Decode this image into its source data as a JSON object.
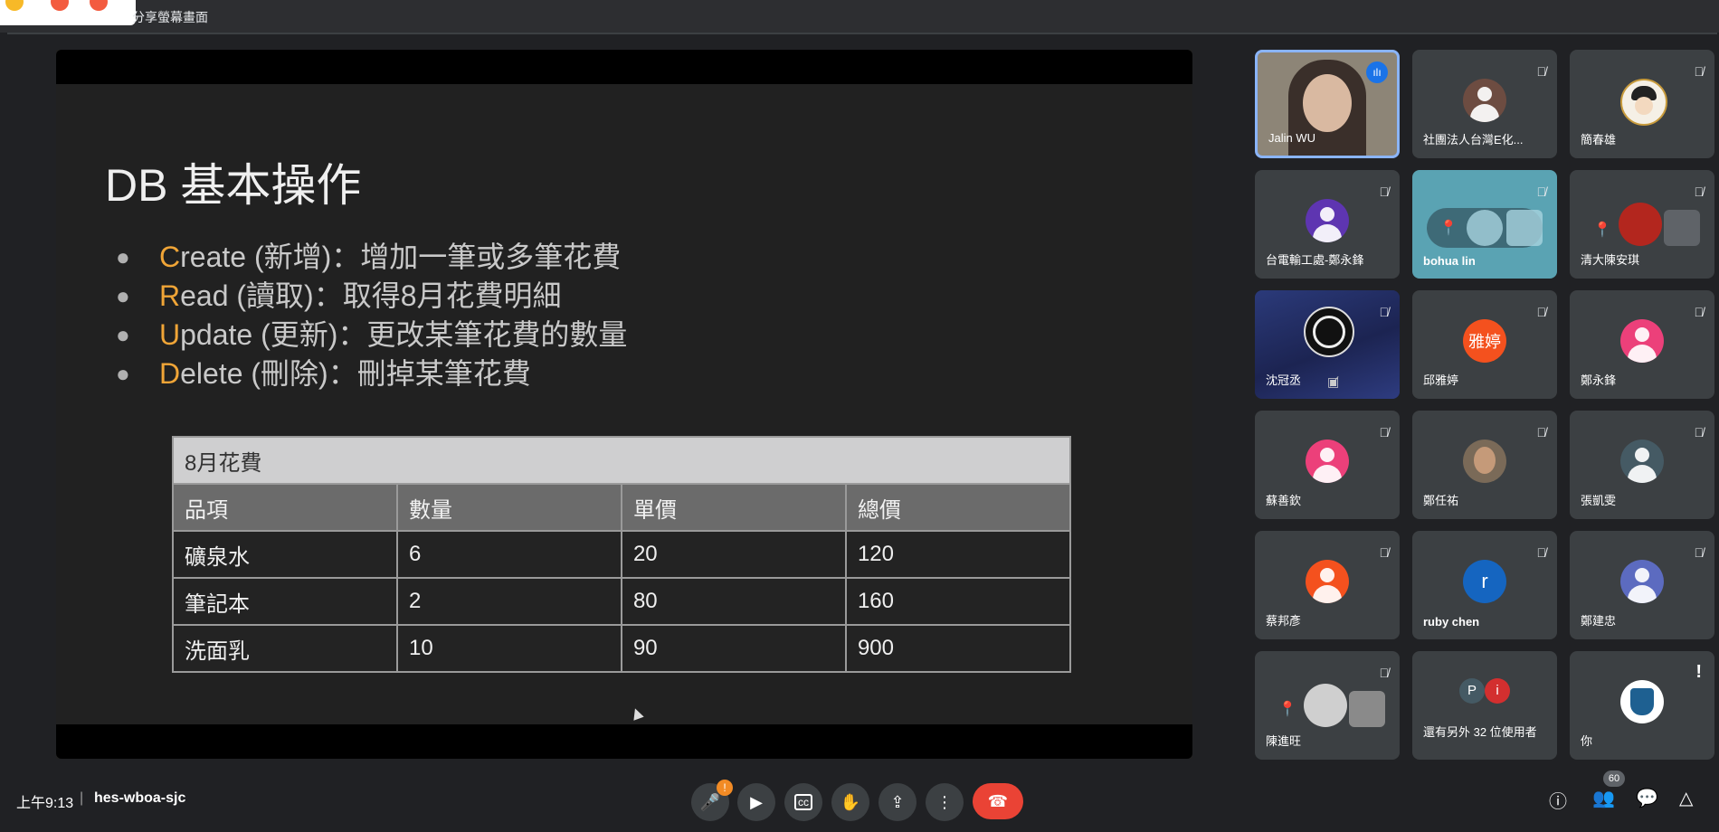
{
  "top": {
    "share_label": "分享螢幕畫面"
  },
  "slide": {
    "title": "DB 基本操作",
    "bullets": [
      {
        "letter": "C",
        "rest": "reate (新增)：增加一筆或多筆花費"
      },
      {
        "letter": "R",
        "rest": "ead (讀取)：取得8月花費明細"
      },
      {
        "letter": "U",
        "rest": "pdate (更新)：更改某筆花費的數量"
      },
      {
        "letter": "D",
        "rest": "elete (刪除)：刪掉某筆花費"
      }
    ],
    "table": {
      "caption": "8月花費",
      "headers": [
        "品項",
        "數量",
        "單價",
        "總價"
      ],
      "rows": [
        [
          "礦泉水",
          "6",
          "20",
          "120"
        ],
        [
          "筆記本",
          "2",
          "80",
          "160"
        ],
        [
          "洗面乳",
          "10",
          "90",
          "900"
        ]
      ]
    }
  },
  "participants": [
    {
      "name": "Jalin WU",
      "kind": "video"
    },
    {
      "name": "社團法人台灣E化...",
      "kind": "avatar"
    },
    {
      "name": "簡春雄",
      "kind": "avatar"
    },
    {
      "name": "台電輸工處-鄭永鋒",
      "kind": "avatar"
    },
    {
      "name": "bohua lin",
      "kind": "pinned"
    },
    {
      "name": "清大陳安琪",
      "kind": "pinned"
    },
    {
      "name": "沈冠丞",
      "kind": "logo"
    },
    {
      "name": "邱雅婷",
      "kind": "text",
      "initials": "雅婷"
    },
    {
      "name": "鄭永鋒",
      "kind": "avatar"
    },
    {
      "name": "蘇善欽",
      "kind": "avatar"
    },
    {
      "name": "鄭任祐",
      "kind": "photo"
    },
    {
      "name": "張凱雯",
      "kind": "avatar"
    },
    {
      "name": "蔡邦彥",
      "kind": "avatar"
    },
    {
      "name": "ruby chen",
      "kind": "text",
      "initials": "r"
    },
    {
      "name": "鄭建忠",
      "kind": "avatar"
    },
    {
      "name": "陳進旺",
      "kind": "pinned"
    },
    {
      "name": "還有另外 32 位使用者",
      "kind": "others",
      "initials": [
        "P",
        "i"
      ]
    },
    {
      "name": "你",
      "kind": "self"
    }
  ],
  "bottom": {
    "time": "上午9:13",
    "meeting_code": "hes-wboa-sjc",
    "participant_count": "60",
    "mic_badge": "!"
  },
  "colors": {
    "accent_orange": "#f0a537",
    "end_call": "#ea4335",
    "active_speaker_border": "#8ab4f8"
  }
}
